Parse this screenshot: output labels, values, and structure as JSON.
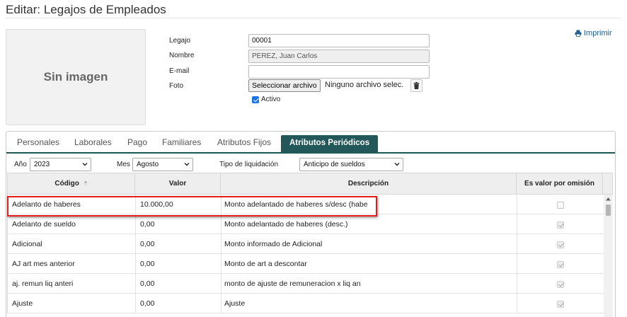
{
  "page": {
    "title": "Editar: Legajos de Empleados"
  },
  "photo": {
    "placeholder": "Sin imagen"
  },
  "print": {
    "label": "Imprimir"
  },
  "form": {
    "legajo": {
      "label": "Legajo",
      "value": "00001"
    },
    "nombre": {
      "label": "Nombre",
      "value": "PEREZ, Juan Carlos"
    },
    "email": {
      "label": "E-mail",
      "value": ""
    },
    "foto": {
      "label": "Foto",
      "button": "Seleccionar archivo",
      "status": "Ninguno archivo selec."
    },
    "activo": {
      "label": "Activo",
      "checked": true
    }
  },
  "tabs": [
    {
      "label": "Personales",
      "active": false
    },
    {
      "label": "Laborales",
      "active": false
    },
    {
      "label": "Pago",
      "active": false
    },
    {
      "label": "Familiares",
      "active": false
    },
    {
      "label": "Atributos Fijos",
      "active": false
    },
    {
      "label": "Atributos Periódicos",
      "active": true
    }
  ],
  "filters": {
    "anio": {
      "label": "Año",
      "value": "2023"
    },
    "mes": {
      "label": "Mes",
      "value": "Agosto"
    },
    "tipo": {
      "label": "Tipo de liquidación",
      "value": "Anticipo de sueldos"
    }
  },
  "grid": {
    "columns": {
      "codigo": "Código",
      "sort_icon": "sort-icon",
      "valor": "Valor",
      "descripcion": "Descripción",
      "omision": "Es valor por omisión"
    },
    "rows": [
      {
        "codigo": "Adelanto de haberes",
        "valor": "10.000,00",
        "descripcion": "Monto adelantado de haberes s/desc (habe",
        "omision": false,
        "highlighted": true
      },
      {
        "codigo": "Adelanto de sueldo",
        "valor": "0,00",
        "descripcion": "Monto adelantado de haberes (desc.)",
        "omision": true
      },
      {
        "codigo": "Adicional",
        "valor": "0,00",
        "descripcion": "Monto informado de Adicional",
        "omision": true
      },
      {
        "codigo": "AJ art mes anterior",
        "valor": "0,00",
        "descripcion": "Monto de art a descontar",
        "omision": true
      },
      {
        "codigo": "aj. remun liq anteri",
        "valor": "0,00",
        "descripcion": "monto de ajuste de remuneracion x liq an",
        "omision": true
      },
      {
        "codigo": "Ajuste",
        "valor": "0,00",
        "descripcion": "Ajuste",
        "omision": true
      }
    ]
  },
  "colors": {
    "accent": "#23585a",
    "highlight": "#e41c1c",
    "link": "#1f5d8c"
  }
}
